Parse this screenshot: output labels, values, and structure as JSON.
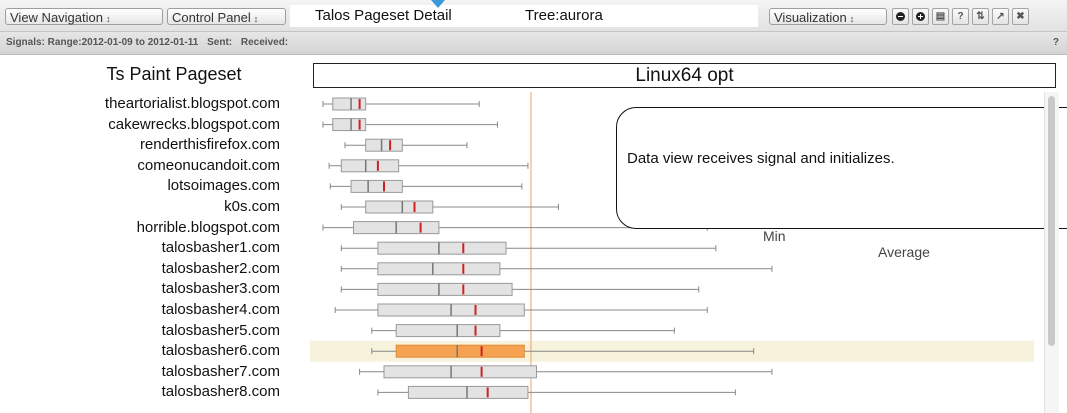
{
  "toolbar": {
    "view_navigation": "View Navigation",
    "control_panel": "Control Panel",
    "title": "Talos Pageset Detail",
    "tree": "Tree:aurora",
    "visualization": "Visualization",
    "dropdown_arrow": "↕",
    "buttons": [
      "zoom-out",
      "zoom-in",
      "pop-out",
      "help",
      "link",
      "open-external",
      "close"
    ],
    "help_label": "?",
    "close_label": "✖"
  },
  "signals": {
    "range_label": "Signals: Range:2012-01-09 to 2012-01-11",
    "sent_label": "Sent:",
    "received_label": "Received:",
    "help_label": "?"
  },
  "plot": {
    "heading": "Ts Paint Pageset",
    "platform": "Linux64 opt",
    "annotation": "Data view receives signal and initializes.",
    "legend_min": "Min",
    "legend_average": "Average",
    "highlight_color": "#f5a352",
    "average_color": "#cc2222",
    "sites": [
      {
        "name": "theartorialist.blogspot.com",
        "min": 0,
        "q1": 8,
        "median": 23,
        "q3": 35,
        "max": 128,
        "avg": 30
      },
      {
        "name": "cakewrecks.blogspot.com",
        "min": 0,
        "q1": 8,
        "median": 23,
        "q3": 35,
        "max": 143,
        "avg": 30
      },
      {
        "name": "renderthisfirefox.com",
        "min": 18,
        "q1": 35,
        "median": 48,
        "q3": 65,
        "max": 118,
        "avg": 55
      },
      {
        "name": "comeonucandoit.com",
        "min": 5,
        "q1": 15,
        "median": 35,
        "q3": 62,
        "max": 168,
        "avg": 45
      },
      {
        "name": "lotsoimages.com",
        "min": 6,
        "q1": 23,
        "median": 37,
        "q3": 65,
        "max": 163,
        "avg": 50
      },
      {
        "name": "k0s.com",
        "min": 15,
        "q1": 35,
        "median": 65,
        "q3": 90,
        "max": 193,
        "avg": 75
      },
      {
        "name": "horrible.blogspot.com",
        "min": 0,
        "q1": 25,
        "median": 60,
        "q3": 95,
        "max": 315,
        "avg": 80
      },
      {
        "name": "talosbasher1.com",
        "min": 15,
        "q1": 45,
        "median": 95,
        "q3": 150,
        "max": 322,
        "avg": 115
      },
      {
        "name": "talosbasher2.com",
        "min": 15,
        "q1": 45,
        "median": 90,
        "q3": 145,
        "max": 368,
        "avg": 115
      },
      {
        "name": "talosbasher3.com",
        "min": 15,
        "q1": 45,
        "median": 95,
        "q3": 155,
        "max": 308,
        "avg": 115
      },
      {
        "name": "talosbasher4.com",
        "min": 10,
        "q1": 45,
        "median": 105,
        "q3": 165,
        "max": 315,
        "avg": 125
      },
      {
        "name": "talosbasher5.com",
        "min": 40,
        "q1": 60,
        "median": 110,
        "q3": 145,
        "max": 288,
        "avg": 125
      },
      {
        "name": "talosbasher6.com",
        "min": 40,
        "q1": 60,
        "median": 110,
        "q3": 165,
        "max": 353,
        "avg": 130,
        "highlight": true
      },
      {
        "name": "talosbasher7.com",
        "min": 30,
        "q1": 50,
        "median": 105,
        "q3": 175,
        "max": 368,
        "avg": 130
      },
      {
        "name": "talosbasher8.com",
        "min": 45,
        "q1": 70,
        "median": 118,
        "q3": 168,
        "max": 338,
        "avg": 135
      }
    ]
  }
}
